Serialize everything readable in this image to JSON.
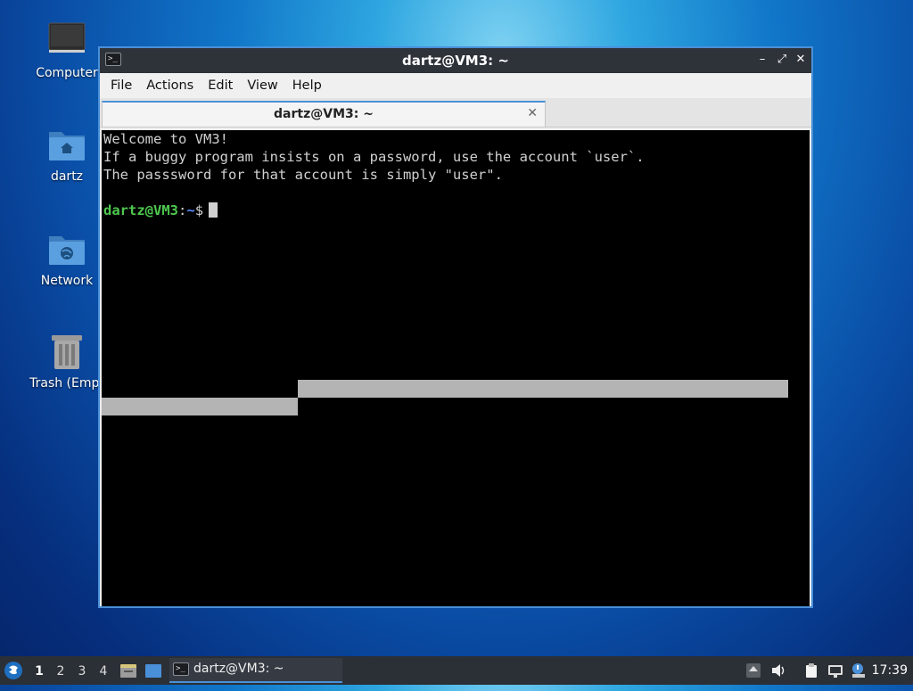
{
  "desktop": {
    "icons": [
      {
        "label": "Computer",
        "icon": "monitor-icon"
      },
      {
        "label": "dartz",
        "icon": "home-folder-icon"
      },
      {
        "label": "Network",
        "icon": "network-folder-icon"
      },
      {
        "label": "Trash (Empt",
        "icon": "trash-icon"
      }
    ]
  },
  "window": {
    "title": "dartz@VM3: ~",
    "controls": {
      "minimize": "–",
      "maximize": "⤢",
      "close": "✕"
    },
    "menu": [
      "File",
      "Actions",
      "Edit",
      "View",
      "Help"
    ],
    "tab": {
      "label": "dartz@VM3: ~",
      "close": "✕"
    }
  },
  "terminal": {
    "lines": [
      "Welcome to VM3!",
      "If a buggy program insists on a password, use the account `user`.",
      "The passsword for that account is simply \"user\"."
    ],
    "prompt": {
      "user_host": "dartz@VM3",
      "sep": ":",
      "path": "~",
      "symbol": "$"
    }
  },
  "taskbar": {
    "workspaces": [
      "1",
      "2",
      "3",
      "4"
    ],
    "active_workspace": "1",
    "task": {
      "label": "dartz@VM3: ~"
    },
    "clock": "17:39"
  },
  "colors": {
    "accent": "#4a90d9",
    "prompt_user": "#4ec84e",
    "prompt_path": "#5a8cff",
    "taskbar_bg": "#2b2f36"
  }
}
